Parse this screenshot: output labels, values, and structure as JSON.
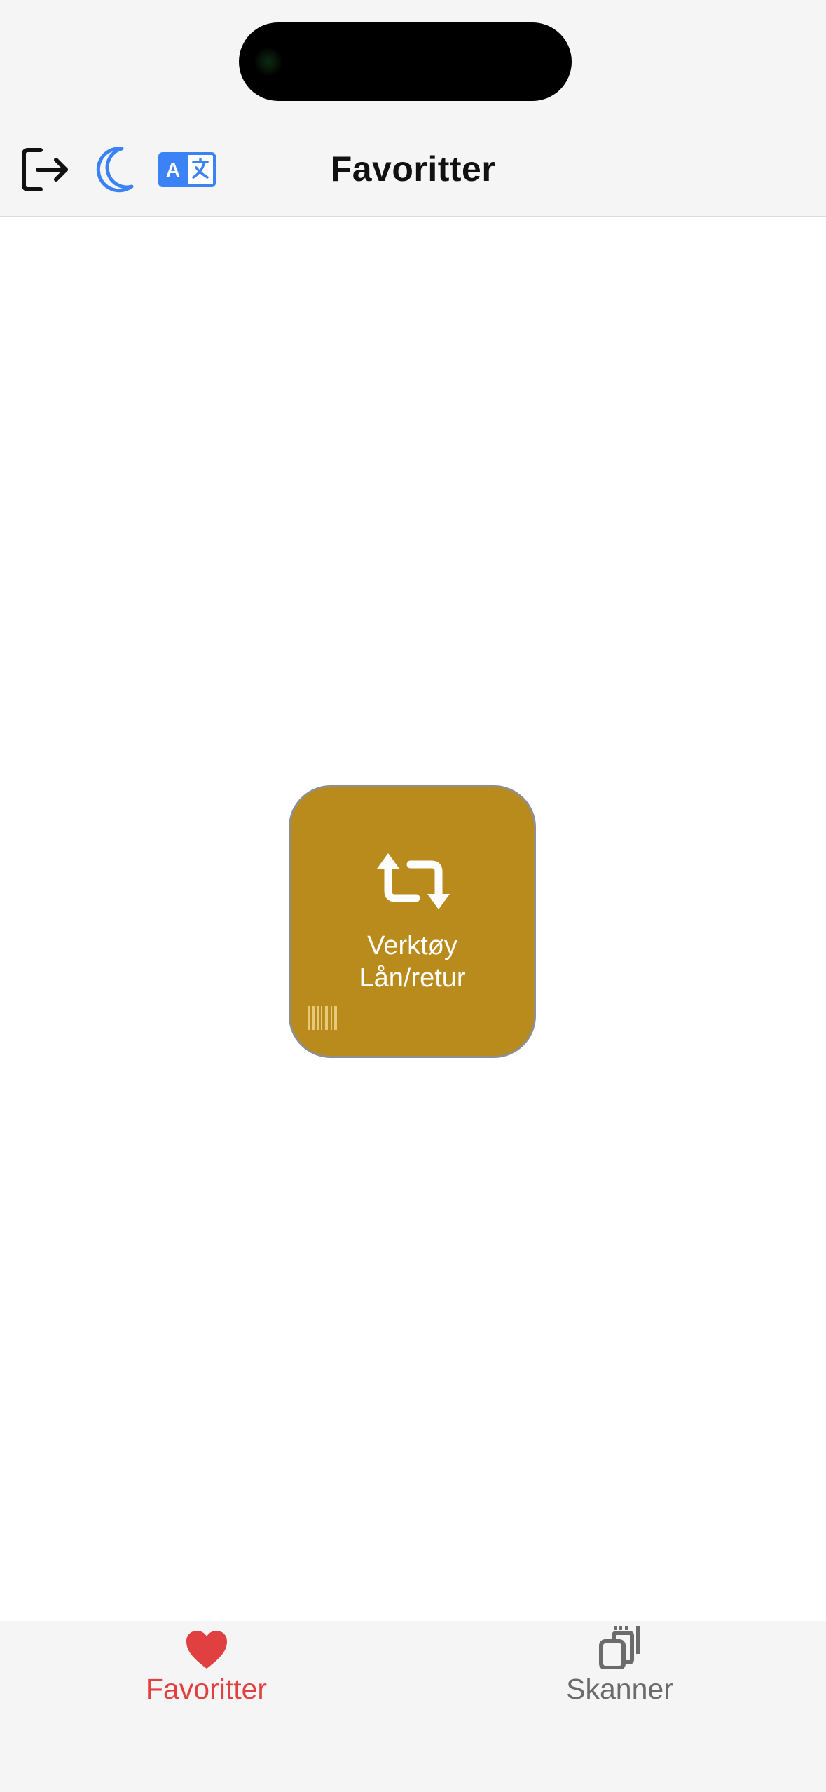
{
  "header": {
    "title": "Favoritter",
    "icons": {
      "logout": "logout-icon",
      "theme": "moon-icon",
      "language": "translate-icon"
    },
    "accent_color": "#3b82f6"
  },
  "favorites": [
    {
      "line1": "Verktøy",
      "line2": "Lån/retur",
      "icon": "swap-arrows-icon",
      "badge_icon": "barcode-icon",
      "color": "#b98b1c"
    }
  ],
  "tab_bar": {
    "tabs": [
      {
        "label": "Favoritter",
        "icon": "heart-icon",
        "active": true,
        "color": "#e0403f"
      },
      {
        "label": "Skanner",
        "icon": "scanner-icon",
        "active": false,
        "color": "#6b6b6b"
      }
    ]
  }
}
